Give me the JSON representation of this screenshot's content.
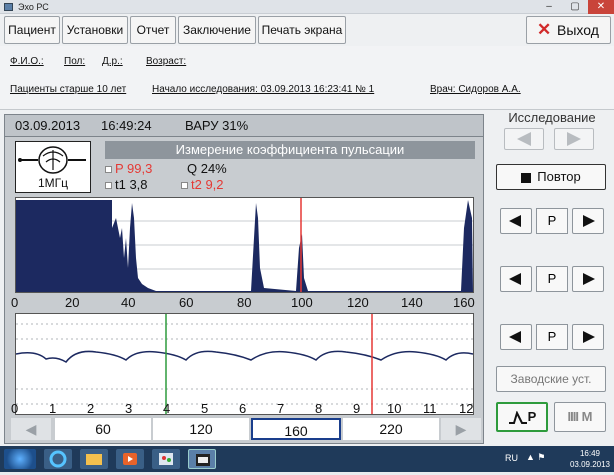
{
  "window": {
    "title": "Эхо РС"
  },
  "menu": {
    "items": [
      "Пациент",
      "Установки",
      "Отчет",
      "Заключение",
      "Печать экрана"
    ],
    "exit_label": "Выход"
  },
  "patient": {
    "fio_label": "Ф.И.О.:",
    "sex_label": "Пол:",
    "dob_label": "Д.р.:",
    "age_label": "Возраст:",
    "category": "Пациенты старше 10 лет",
    "study_start": "Начало исследования: 03.09.2013  16:23:41   № 1",
    "doctor": "Врач: Сидоров А.А."
  },
  "header": {
    "date": "03.09.2013",
    "time": "16:49:24",
    "varu": "ВАРУ 31%"
  },
  "measurement": {
    "probe_label": "1МГц",
    "title": "Измерение коэффициента пульсации",
    "p_label": "P 99,3",
    "q_label": "Q 24%",
    "t1_label": "t1 3,8",
    "t2_label": "t2 9,2",
    "colors": {
      "red": "#e53935",
      "signal": "#1c2960",
      "green": "#2e9b3c"
    }
  },
  "axis_top": {
    "ticks": [
      "0",
      "20",
      "40",
      "60",
      "80",
      "100",
      "120",
      "140",
      "160"
    ]
  },
  "axis_bottom": {
    "ticks": [
      "0",
      "1",
      "2",
      "3",
      "4",
      "5",
      "6",
      "7",
      "8",
      "9",
      "10",
      "11",
      "12"
    ]
  },
  "scale": {
    "values": [
      "60",
      "120",
      "160",
      "220"
    ],
    "selected": "160"
  },
  "sidebar": {
    "title": "Исследование",
    "repeat_label": "Повтор",
    "p_labels": [
      "P",
      "P",
      "P"
    ],
    "factory_label": "Заводские уст.",
    "mode1_label": "P",
    "mode2_label": "M"
  },
  "taskbar": {
    "lang": "RU",
    "time": "16:49",
    "date": "03.09.2013"
  }
}
